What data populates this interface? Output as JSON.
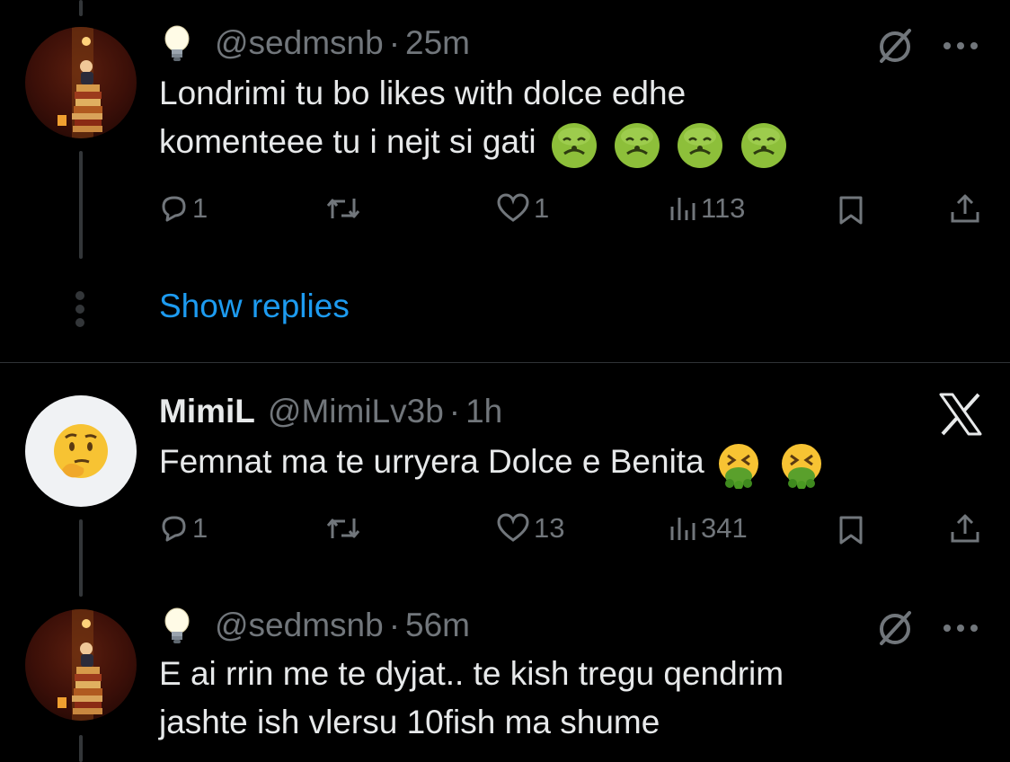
{
  "tweets": [
    {
      "author_display": "",
      "handle": "@sedmsnb",
      "separator": "·",
      "time": "25m",
      "lines": [
        "Londrimi tu bo likes with dolce edhe",
        "komenteee tu i nejt si gati"
      ],
      "emojis": [
        "nauseated-face-emoji",
        "nauseated-face-emoji",
        "nauseated-face-emoji",
        "nauseated-face-emoji"
      ],
      "actions": {
        "replies": "1",
        "reposts": "",
        "likes": "1",
        "views": "113"
      }
    },
    {
      "author_display": "MimiL",
      "handle": "@MimiLv3b",
      "separator": "·",
      "time": "1h",
      "lines": [
        "Femnat ma te urryera Dolce e Benita"
      ],
      "emojis": [
        "vomiting-face-emoji",
        "vomiting-face-emoji"
      ],
      "actions": {
        "replies": "1",
        "reposts": "",
        "likes": "13",
        "views": "341"
      }
    },
    {
      "author_display": "",
      "handle": "@sedmsnb",
      "separator": "·",
      "time": "56m",
      "lines": [
        "E ai rrin me te dyjat.. te kish tregu qendrim",
        "jashte ish vlersu 10fish ma shume"
      ],
      "emojis": []
    }
  ],
  "show_replies_label": "Show replies",
  "icons": {
    "badge": "lightbulb-icon",
    "muted": "muted-circle-icon",
    "more": "more-dots-icon",
    "x_logo": "x-logo-icon"
  },
  "colors": {
    "background": "#000000",
    "text": "#e7e9ea",
    "secondary": "#71767b",
    "link": "#1d9bf0"
  }
}
